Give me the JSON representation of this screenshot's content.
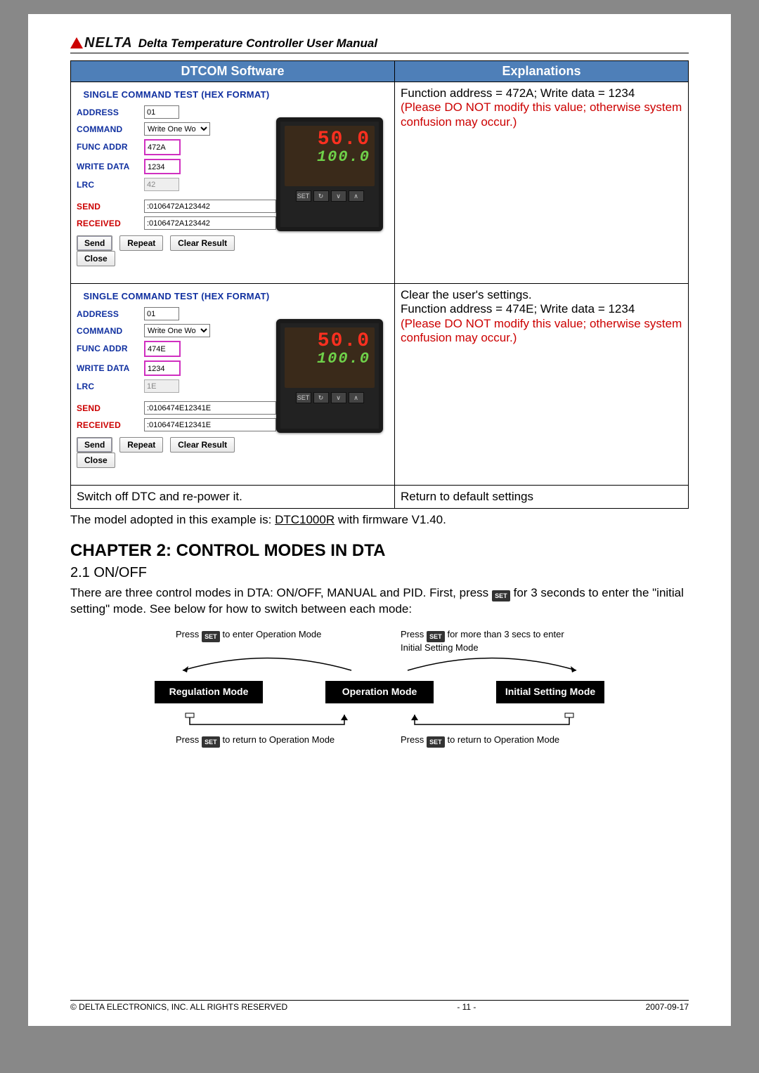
{
  "header": {
    "brand": "NELTA",
    "title": "Delta Temperature Controller User Manual"
  },
  "table": {
    "col1": "DTCOM Software",
    "col2": "Explanations",
    "panel_title": "SINGLE COMMAND TEST (HEX FORMAT)",
    "labels": {
      "address": "ADDRESS",
      "command": "COMMAND",
      "func_addr": "FUNC ADDR",
      "write_data": "WRITE DATA",
      "lrc": "LRC",
      "send": "SEND",
      "received": "RECEIVED"
    },
    "command_option": "Write One Wo",
    "buttons": {
      "send": "Send",
      "repeat": "Repeat",
      "clear": "Clear Result",
      "close": "Close"
    },
    "device": {
      "pv": "50.0",
      "sv": "100.0"
    },
    "row1": {
      "address": "01",
      "func_addr": "472A",
      "write_data": "1234",
      "lrc": "42",
      "send_str": ":0106472A123442",
      "recv_str": ":0106472A123442",
      "expl_line1": "Function address = 472A; Write data = 1234",
      "expl_warn": "(Please DO NOT modify this value; otherwise system confusion may occur.)"
    },
    "row2": {
      "address": "01",
      "func_addr": "474E",
      "write_data": "1234",
      "lrc": "1E",
      "send_str": ":0106474E12341E",
      "recv_str": ":0106474E12341E",
      "expl_line0": "Clear the user's settings.",
      "expl_line1": "Function address = 474E; Write data = 1234",
      "expl_warn": "(Please DO NOT modify this value; otherwise system confusion may occur.)"
    },
    "row3": {
      "left": "Switch off DTC and re-power it.",
      "right": "Return to default settings"
    }
  },
  "after_note": {
    "pre": "The model adopted in this example is: ",
    "model": "DTC1000R",
    "post": " with firmware V1.40."
  },
  "chapter": {
    "heading": "CHAPTER 2: CONTROL MODES IN DTA",
    "section": "2.1 ON/OFF",
    "body_pre": "There are three control modes in DTA: ON/OFF, MANUAL and PID. First, press ",
    "key": "SET",
    "body_post": " for 3 seconds to enter the \"initial setting\" mode. See below for how to switch between each mode:"
  },
  "diagram": {
    "top_left_pre": "Press ",
    "top_left_post": " to enter Operation Mode",
    "top_right_pre": "Press ",
    "top_right_post": " for more than 3 secs to enter Initial Setting Mode",
    "mode1": "Regulation Mode",
    "mode2": "Operation Mode",
    "mode3": "Initial Setting Mode",
    "bot_left_pre": "Press ",
    "bot_left_post": " to return to Operation Mode",
    "bot_right_pre": "Press ",
    "bot_right_post": " to return to Operation Mode",
    "key": "SET"
  },
  "footer": {
    "left": "© DELTA ELECTRONICS, INC. ALL RIGHTS RESERVED",
    "mid": "- 11 -",
    "right": "2007-09-17"
  }
}
